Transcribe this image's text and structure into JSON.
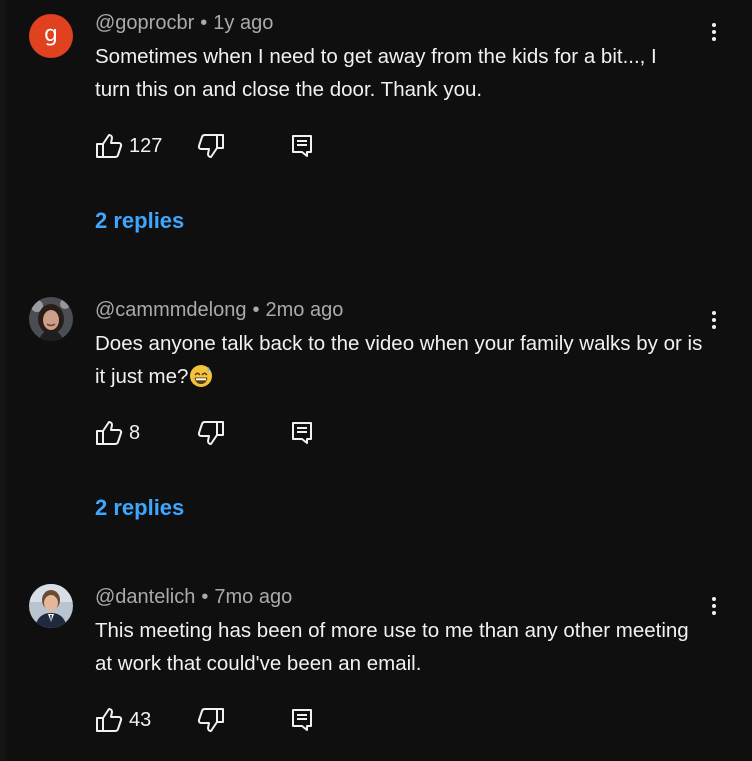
{
  "comments": [
    {
      "avatar_letter": "g",
      "author": "@goprocbr",
      "separator": "•",
      "time": "1y ago",
      "text": "Sometimes when I need to get away from the kids for a bit..., I turn this on and close the door.  Thank you.",
      "likes": "127",
      "replies": "2 replies"
    },
    {
      "author": "@cammmdelong",
      "separator": "•",
      "time": "2mo ago",
      "text": "Does anyone talk back to the video when your family walks by or is it just me?",
      "emoji": "grinning-sweat-emoji",
      "likes": "8",
      "replies": "2 replies"
    },
    {
      "author": "@dantelich",
      "separator": "•",
      "time": "7mo ago",
      "text": "This meeting has been of more use to me than any other meeting at work that could've been an email.",
      "likes": "43"
    }
  ],
  "icons": {
    "like": "thumbs-up-icon",
    "dislike": "thumbs-down-icon",
    "reply": "reply-comment-icon",
    "menu": "more-vert-icon"
  },
  "colors": {
    "background": "#0f0f0f",
    "text": "#f1f1f1",
    "meta": "#aaaaaa",
    "link": "#3ea6ff",
    "avatar_g": "#e0421f"
  }
}
